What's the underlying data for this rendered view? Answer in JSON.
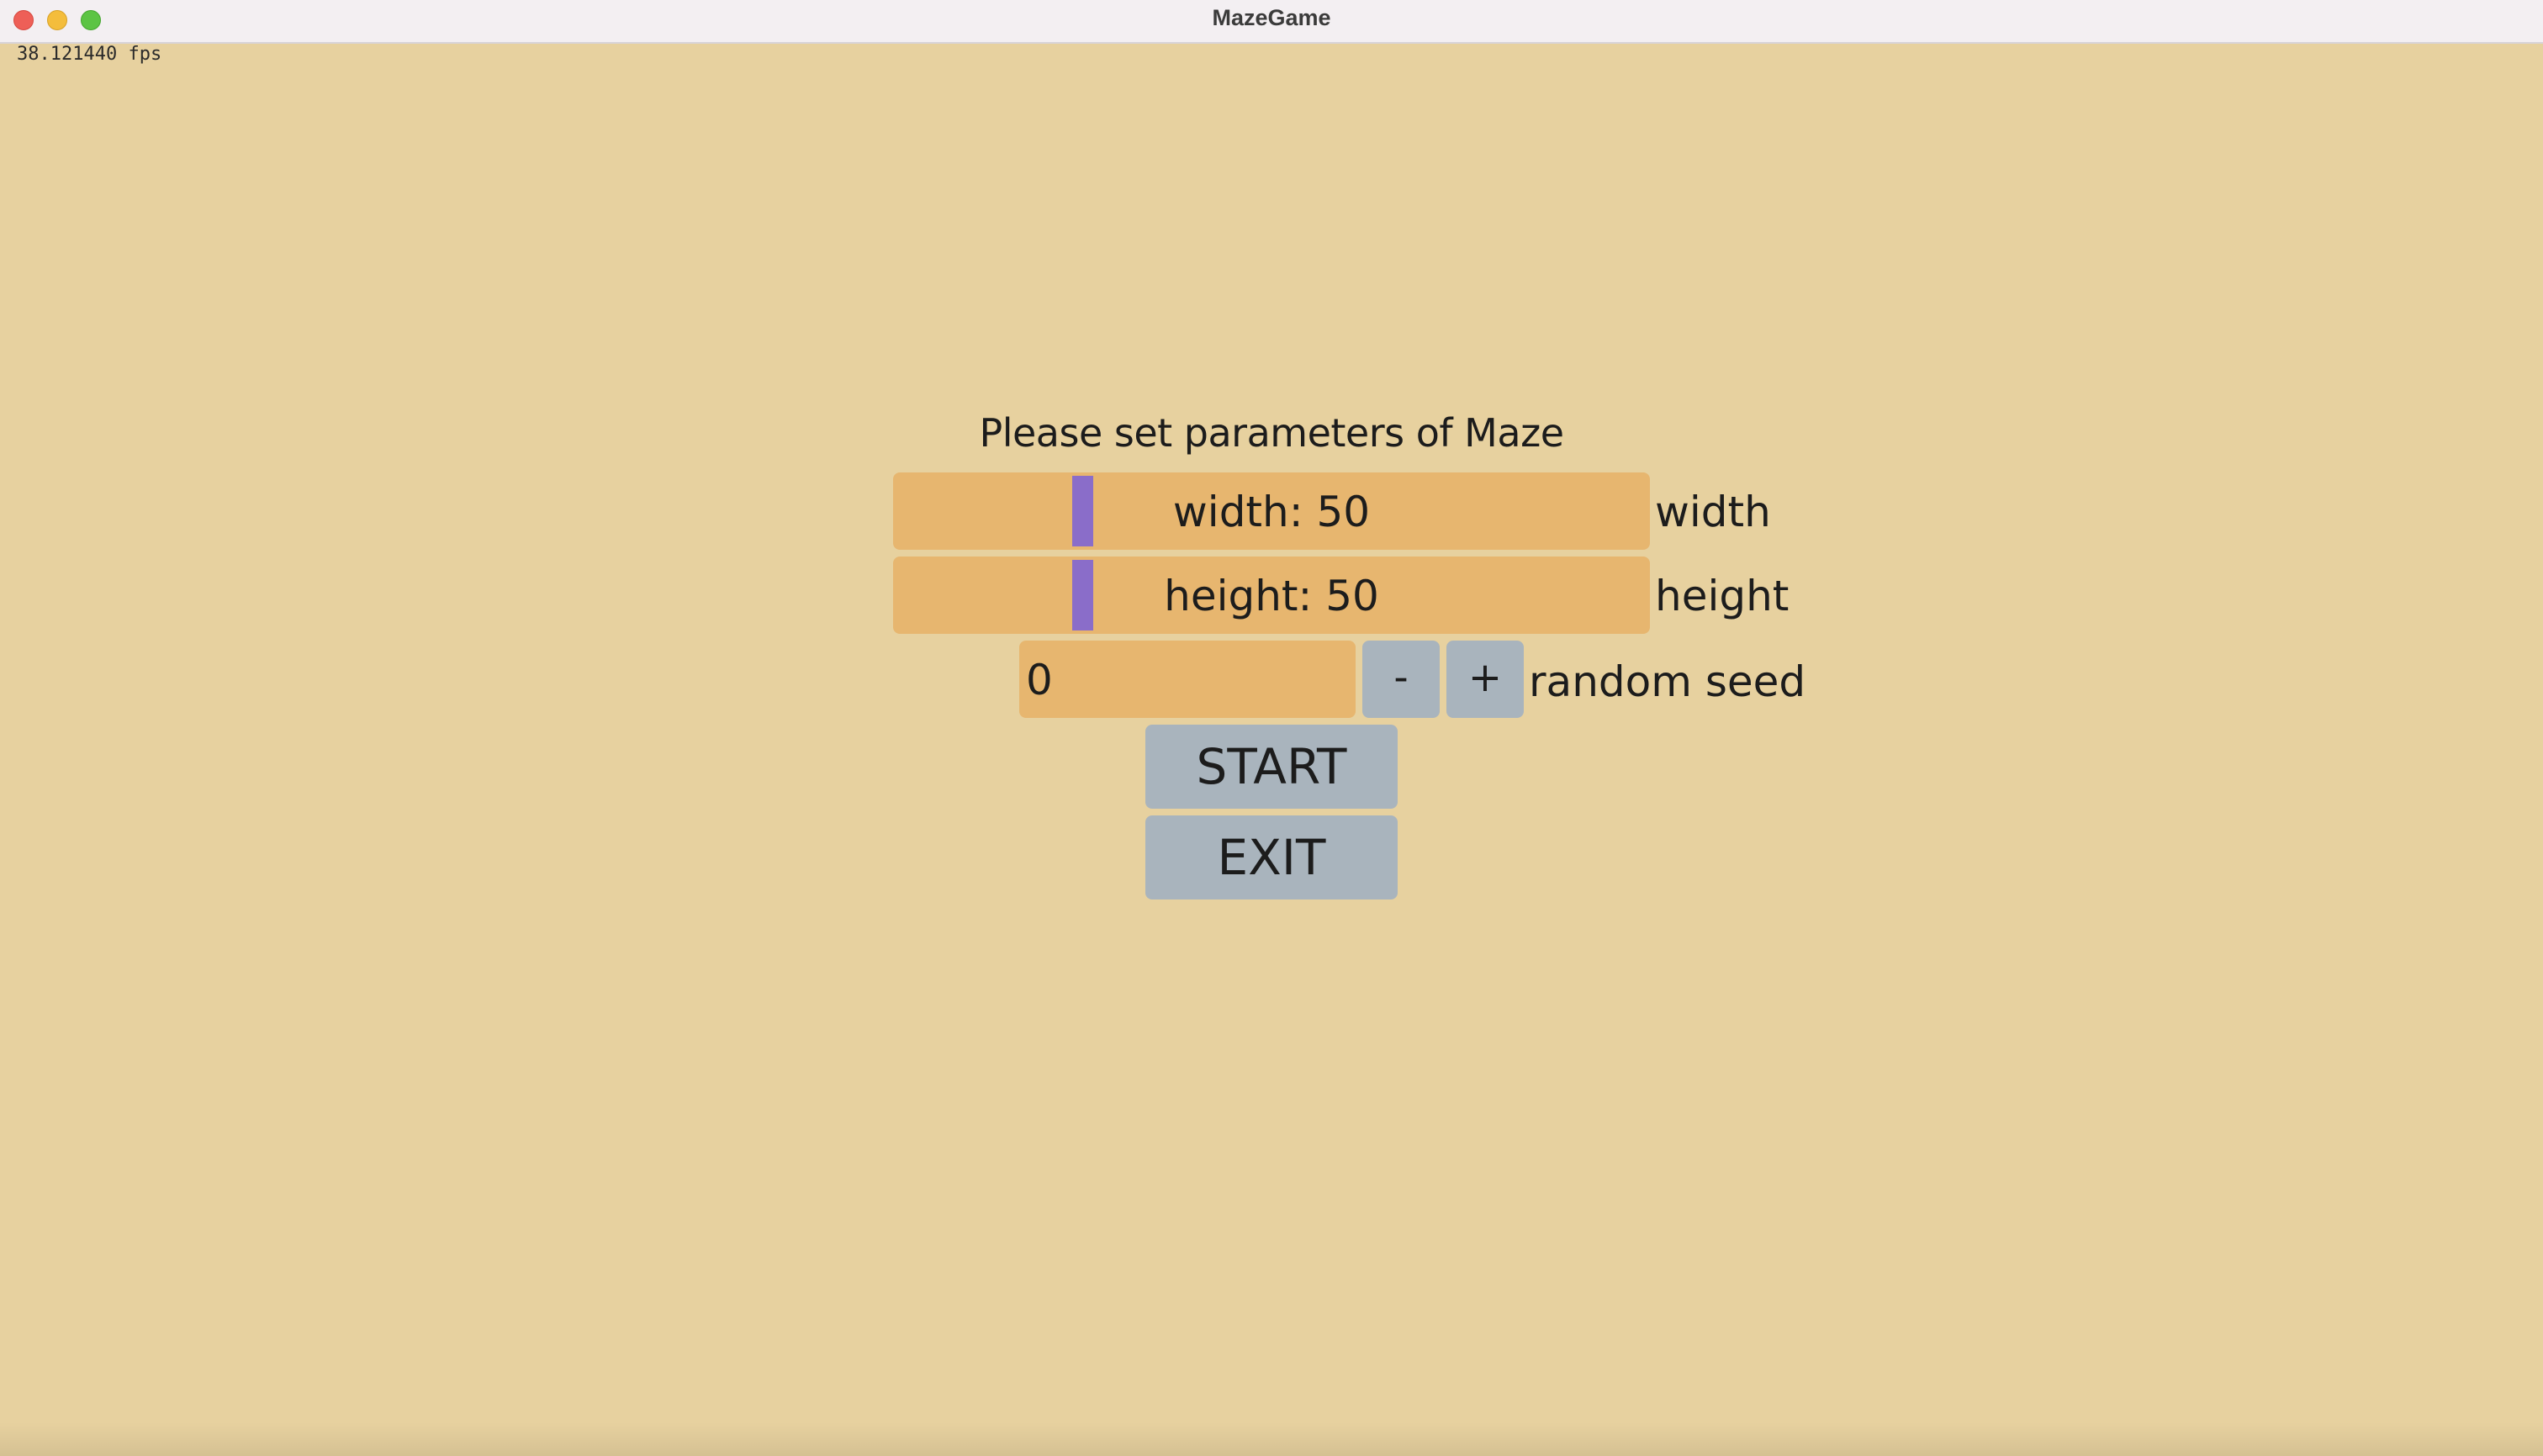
{
  "window": {
    "title": "MazeGame",
    "controls": [
      "close",
      "minimize",
      "maximize"
    ]
  },
  "fps": "38.121440 fps",
  "heading": "Please set parameters of Maze",
  "sliders": {
    "width": {
      "text": "width: 50",
      "label": "width",
      "value": 50,
      "fill_fraction": 0.25
    },
    "height": {
      "text": "height: 50",
      "label": "height",
      "value": 50,
      "fill_fraction": 0.25
    }
  },
  "seed": {
    "value": "0",
    "minus_label": "-",
    "plus_label": "+",
    "label": "random seed"
  },
  "buttons": {
    "start": "START",
    "exit": "EXIT"
  },
  "colors": {
    "background": "#e7d19f",
    "field": "#e7b66f",
    "thumb": "#8a6dc9",
    "button": "#a9b4bd"
  }
}
